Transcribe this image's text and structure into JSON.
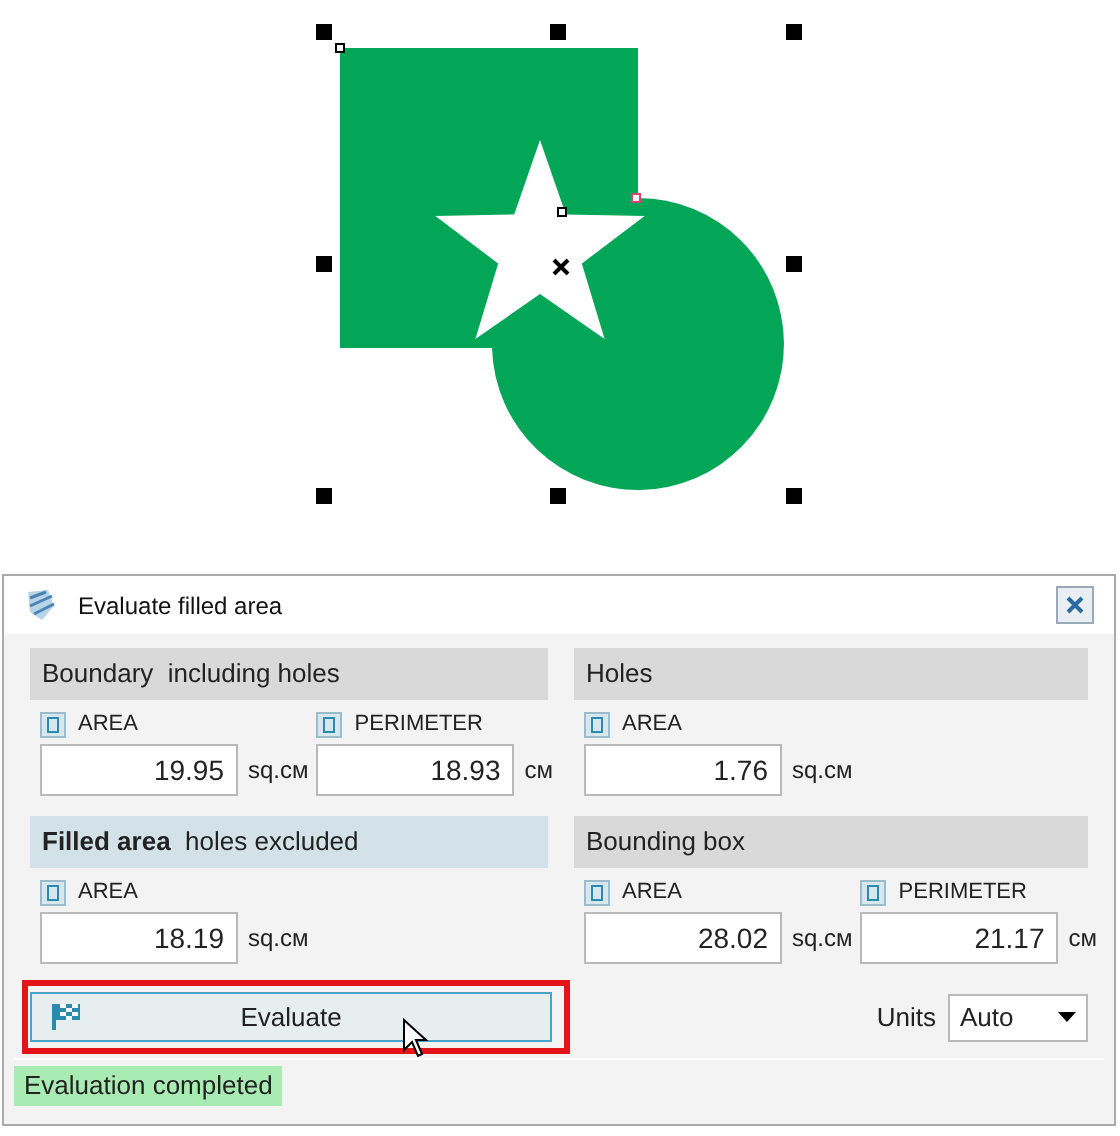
{
  "dialog": {
    "title": "Evaluate filled area",
    "sections": [
      {
        "header": "Boundary  including holes",
        "highlighted": false,
        "measures": [
          {
            "label": "AREA",
            "value": "19.95",
            "unit": "sq.см"
          },
          {
            "label": "PERIMETER",
            "value": "18.93",
            "unit": "см"
          }
        ]
      },
      {
        "header": "Holes",
        "highlighted": false,
        "measures": [
          {
            "label": "AREA",
            "value": "1.76",
            "unit": "sq.см"
          }
        ]
      },
      {
        "header": "**Filled area**  holes excluded",
        "highlighted": true,
        "measures": [
          {
            "label": "AREA",
            "value": "18.19",
            "unit": "sq.см"
          }
        ]
      },
      {
        "header": "Bounding box",
        "highlighted": false,
        "measures": [
          {
            "label": "AREA",
            "value": "28.02",
            "unit": "sq.см"
          },
          {
            "label": "PERIMETER",
            "value": "21.17",
            "unit": "см"
          }
        ]
      }
    ],
    "evaluate_button": "Evaluate",
    "units": {
      "label": "Units",
      "value": "Auto"
    },
    "status": "Evaluation completed"
  }
}
